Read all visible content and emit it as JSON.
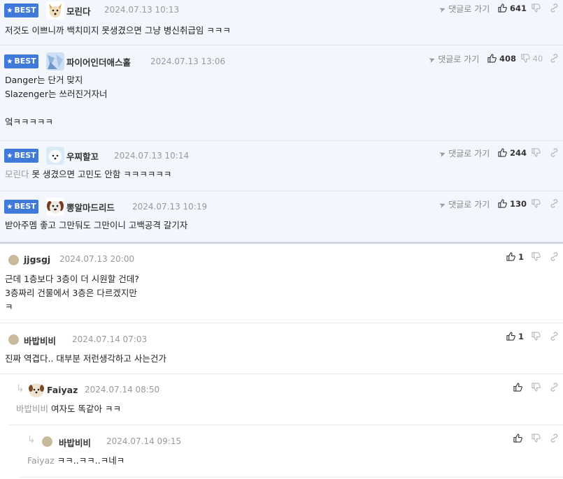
{
  "best_badge": "BEST",
  "reply_link_label": "댓글로 가기",
  "best_comments": [
    {
      "nickname": "모린다",
      "date": "2024.07.13 10:13",
      "up": "641",
      "down": "",
      "text": "저것도 이쁘니까 백치미지 못생겼으면 그냥 병신취급임 ㅋㅋㅋ",
      "mention": ""
    },
    {
      "nickname": "파이어인더애스홀",
      "date": "2024.07.13 13:06",
      "up": "408",
      "down": "40",
      "text": "Danger는 단거 맞지\nSlazenger는 쓰러진거자너\n\n엌ㅋㅋㅋㅋㅋ",
      "mention": ""
    },
    {
      "nickname": "우찌할꼬",
      "date": "2024.07.13 10:14",
      "up": "244",
      "down": "",
      "text": "못 생겼으면 고민도 안함 ㅋㅋㅋㅋㅋㅋ",
      "mention": "모린다"
    },
    {
      "nickname": "뽕알마드리드",
      "date": "2024.07.13 10:19",
      "up": "130",
      "down": "",
      "text": "받아주멤 좋고 그만둬도 그만이니 고백공격 갈기자",
      "mention": ""
    }
  ],
  "comments": [
    {
      "nickname": "jjgsgj",
      "date": "2024.07.13 20:00",
      "up": "1",
      "text": "근데 1층보다 3층이 더 시원할 건데?\n3층짜리 건물에서 3층은 다르겠지만\nㅋ",
      "mention": ""
    },
    {
      "nickname": "바밥비비",
      "date": "2024.07.14 07:03",
      "up": "1",
      "text": "진짜 역겹다.. 대부분 저런생각하고 사는건가",
      "mention": ""
    },
    {
      "nickname": "Faiyaz",
      "date": "2024.07.14 08:50",
      "up": "",
      "text": "여자도 똑같아 ㅋㅋ",
      "mention": "바밥비비"
    },
    {
      "nickname": "바밥비비",
      "date": "2024.07.14 09:15",
      "up": "",
      "text": "ㅋㅋ..ㅋㅋ..ㅋ네ㅋ",
      "mention": "Faiyaz"
    }
  ]
}
